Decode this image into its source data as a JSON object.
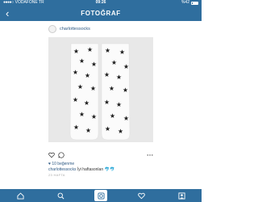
{
  "status_bar": {
    "carrier": "VODAFONE TR",
    "time": "09:26",
    "battery": "%42"
  },
  "nav": {
    "back_icon": "chevron-left-icon",
    "title": "FOTOĞRAF"
  },
  "post": {
    "username": "charlottessocks",
    "likes": "10 beğenme",
    "caption_user": "charlottessocks",
    "caption_text": "İyi haftasonları",
    "caption_emoji": "🐬🐬",
    "time_ago": "23 HAFTA"
  },
  "tabs": [
    {
      "name": "home",
      "icon": "home-icon"
    },
    {
      "name": "search",
      "icon": "search-icon"
    },
    {
      "name": "camera",
      "icon": "camera-icon",
      "active": true
    },
    {
      "name": "activity",
      "icon": "heart-icon"
    },
    {
      "name": "profile",
      "icon": "profile-icon"
    }
  ],
  "colors": {
    "bar": "#2f6e9e",
    "link": "#2f5a85"
  }
}
